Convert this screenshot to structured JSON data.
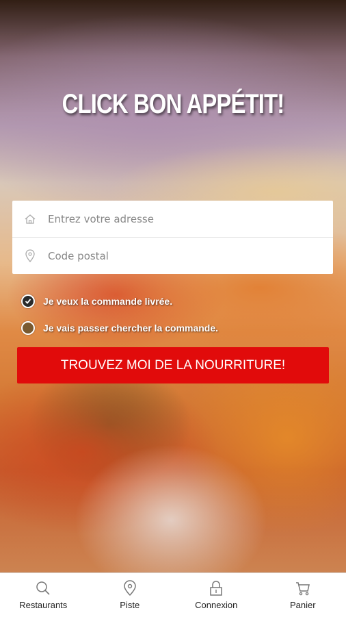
{
  "app": {
    "title": "CLICK BON APPÉTIT!"
  },
  "form": {
    "address_placeholder": "Entrez votre adresse",
    "postal_placeholder": "Code postal"
  },
  "options": {
    "delivery_label": "Je veux la commande livrée.",
    "pickup_label": "Je vais passer chercher la commande."
  },
  "cta": {
    "label": "TROUVEZ MOI DE LA NOURRITURE!"
  },
  "tabs": [
    {
      "label": "Restaurants",
      "icon": "search-icon"
    },
    {
      "label": "Piste",
      "icon": "location-pin-icon"
    },
    {
      "label": "Connexion",
      "icon": "lock-icon"
    },
    {
      "label": "Panier",
      "icon": "cart-icon"
    }
  ],
  "colors": {
    "accent": "#e10b0b"
  }
}
